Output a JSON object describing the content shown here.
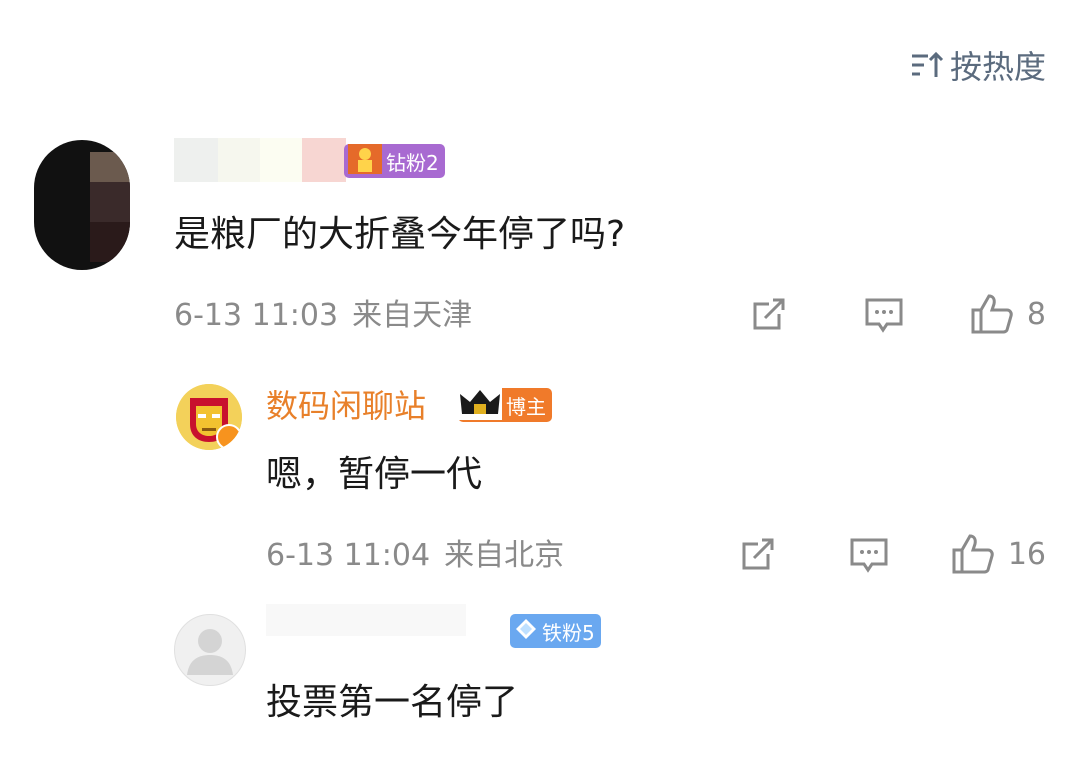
{
  "sort": {
    "label": "按热度",
    "icon": "sort-icon"
  },
  "comments": [
    {
      "badge": {
        "label": "钻粉2",
        "icon": "diamond-fan-icon",
        "color": "#a86ad1"
      },
      "content": "是粮厂的大折叠今年停了吗?",
      "date": "6-13 11:03",
      "location": "来自天津",
      "likes": "8"
    },
    {
      "username": "数码闲聊站",
      "badge": {
        "label": "博主",
        "icon": "crown-icon",
        "color": "#f07a2a"
      },
      "content": "嗯，暂停一代",
      "date": "6-13 11:04",
      "location": "来自北京",
      "likes": "16"
    },
    {
      "badge": {
        "label": "铁粉5",
        "icon": "iron-fan-icon",
        "color": "#6aa8f0"
      },
      "content": "投票第一名停了"
    }
  ],
  "colors": {
    "username_highlight": "#e8802a",
    "meta_text": "#8a8a8a",
    "sort_text": "#5b6b7e"
  }
}
